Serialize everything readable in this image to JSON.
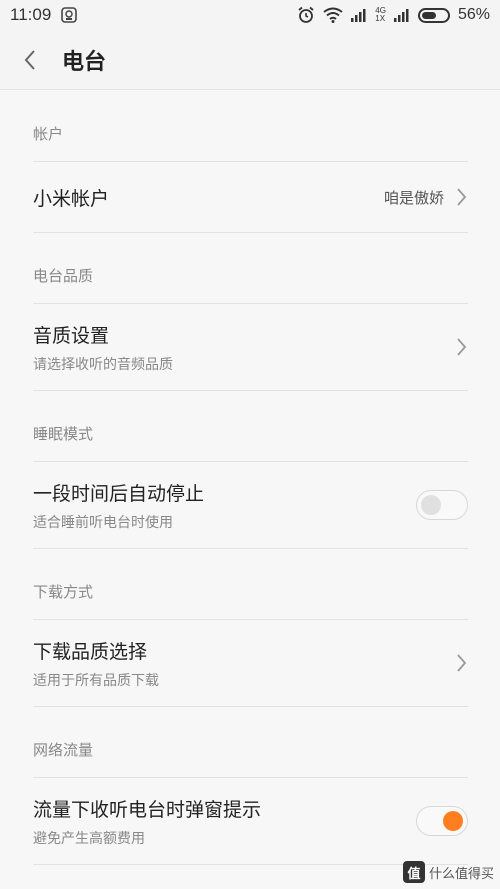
{
  "status_bar": {
    "time": "11:09",
    "network_top": "4G",
    "network_bottom": "1X",
    "battery": "56%",
    "battery_level": 0.56
  },
  "app_bar": {
    "title": "电台"
  },
  "sections": [
    {
      "title": "帐户",
      "item": {
        "title": "小米帐户",
        "value": "咱是傲娇"
      }
    },
    {
      "title": "电台品质",
      "item": {
        "title": "音质设置",
        "subtitle": "请选择收听的音频品质"
      }
    },
    {
      "title": "睡眠模式",
      "item": {
        "title": "一段时间后自动停止",
        "subtitle": "适合睡前听电台时使用",
        "toggle": false
      }
    },
    {
      "title": "下载方式",
      "item": {
        "title": "下载品质选择",
        "subtitle": "适用于所有品质下载"
      }
    },
    {
      "title": "网络流量",
      "item": {
        "title": "流量下收听电台时弹窗提示",
        "subtitle": "避免产生高额费用",
        "toggle": true
      }
    }
  ],
  "watermark": {
    "badge": "值",
    "text": "什么值得买"
  },
  "colors": {
    "accent": "#ff7e1f",
    "background": "#f7f7f7"
  }
}
